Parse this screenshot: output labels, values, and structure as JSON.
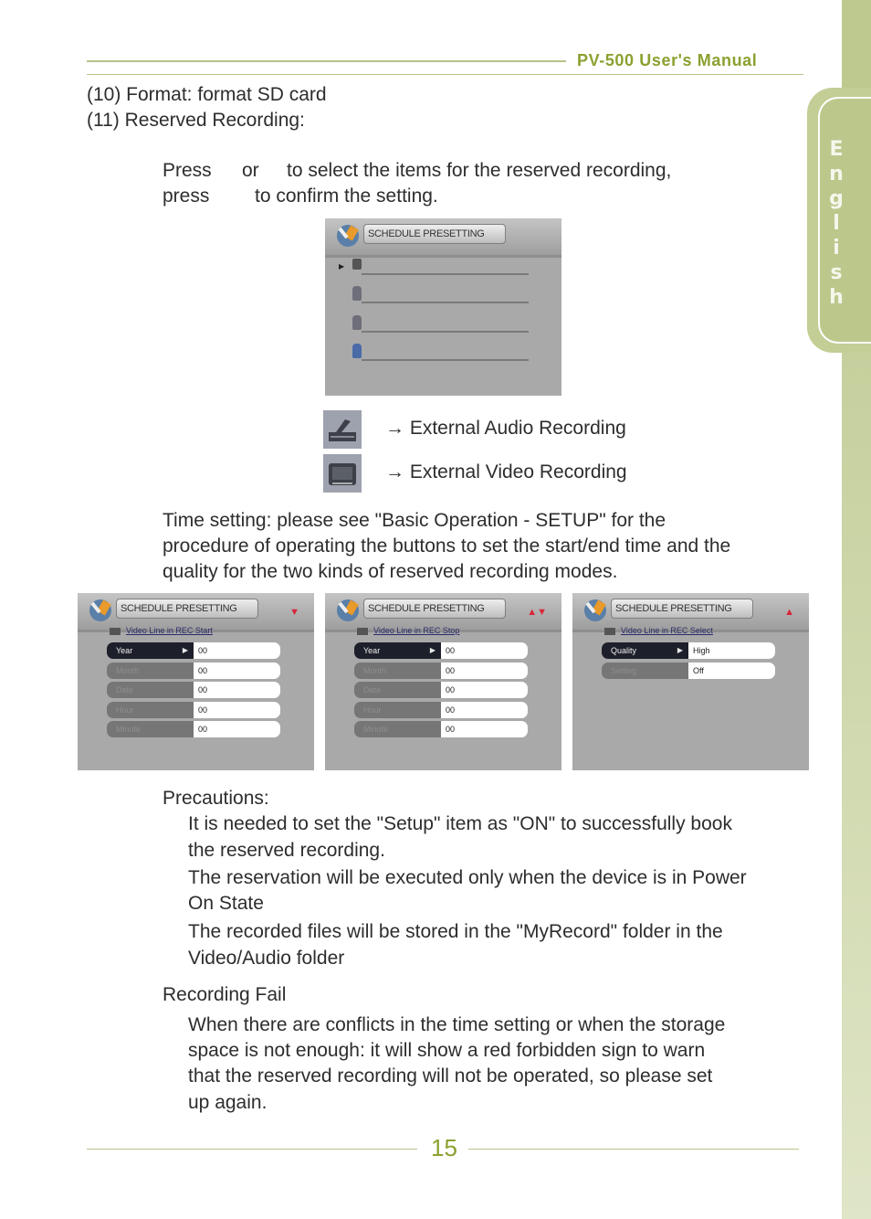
{
  "header": {
    "title": "PV-500 User's Manual"
  },
  "sidebar": {
    "language_tab": "English"
  },
  "items": [
    "(10) Format: format SD card",
    "(11) Reserved Recording:"
  ],
  "instructions": {
    "line1_part1": "Press",
    "line1_part2": "or",
    "line1_part3": "to select the items for the reserved recording,",
    "line2_part1": "press",
    "line2_part2": "to confirm the setting."
  },
  "screenshots": {
    "menu": {
      "title": "SCHEDULE PRESETTING",
      "items": [
        "audio-recording",
        "video-recording",
        "video-recording",
        "video-recording"
      ]
    },
    "panels": [
      {
        "title": "SCHEDULE PRESETTING",
        "arrows": "▼",
        "subtitle": "Video Line in REC Start",
        "rows": [
          {
            "label": "Year",
            "value": "00",
            "selected": true
          },
          {
            "label": "Month",
            "value": "00"
          },
          {
            "label": "Date",
            "value": "00"
          },
          {
            "label": "Hour",
            "value": "00"
          },
          {
            "label": "Minute",
            "value": "00"
          }
        ]
      },
      {
        "title": "SCHEDULE PRESETTING",
        "arrows": "▲▼",
        "subtitle": "Video Line in REC Stop",
        "rows": [
          {
            "label": "Year",
            "value": "00",
            "selected": true
          },
          {
            "label": "Month",
            "value": "00"
          },
          {
            "label": "Date",
            "value": "00"
          },
          {
            "label": "Hour",
            "value": "00"
          },
          {
            "label": "Minute",
            "value": "00"
          }
        ]
      },
      {
        "title": "SCHEDULE PRESETTING",
        "arrows": "▲",
        "subtitle": "Video Line in REC Select",
        "rows": [
          {
            "label": "Quality",
            "value": "High",
            "selected": true
          },
          {
            "label": "Setting",
            "value": "Off"
          }
        ]
      }
    ]
  },
  "legend": [
    {
      "icon": "external-audio-icon",
      "text": "→ External Audio Recording"
    },
    {
      "icon": "external-video-icon",
      "text": "→ External Video Recording"
    }
  ],
  "time_setting": [
    "Time setting: please see \"Basic Operation - SETUP\" for the",
    "procedure of operating the buttons to set the start/end time and the",
    "quality for the two kinds of reserved recording modes."
  ],
  "precautions": {
    "heading": "Precautions:",
    "lines": [
      "It is needed to set the \"Setup\" item as \"ON\" to successfully book",
      "the reserved recording.",
      "The reservation will be executed only when the device is in Power",
      "On State",
      "The recorded files will be stored in the \"MyRecord\" folder in the",
      "Video/Audio folder"
    ]
  },
  "recording_fail": {
    "heading": "Recording Fail",
    "lines": [
      "When there are conflicts in the time setting or when the storage",
      "space is not enough: it will show a red forbidden sign to warn",
      "that the reserved recording will not be operated, so please set",
      "up again."
    ]
  },
  "footer": {
    "page_number": "15"
  },
  "colors": {
    "accent": "#8aa12f",
    "rule": "#b5c48a",
    "sidebar": "#bec98f"
  }
}
